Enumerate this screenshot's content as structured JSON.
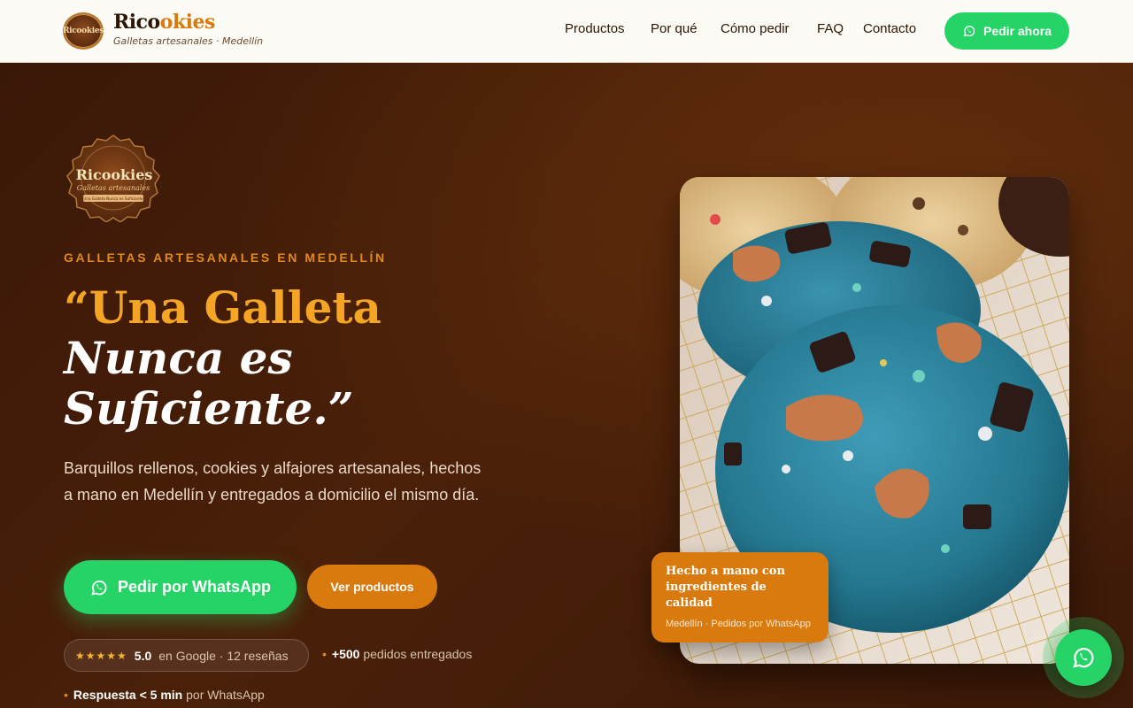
{
  "brand": {
    "name_part1": "Rico",
    "name_part2": "okies",
    "tagline": "Galletas artesanales · Medellín",
    "logo_text": "Ricookies"
  },
  "nav": {
    "items": [
      "Productos",
      "Por qué",
      "Cómo pedir",
      "FAQ",
      "Contacto"
    ],
    "cta_label": "Pedir ahora"
  },
  "hero": {
    "badge": {
      "title": "Ricookies",
      "subtitle": "Galletas artesanales",
      "ribbon": "Una Galleta Nunca es Suficiente"
    },
    "kicker": "GALLETAS ARTESANALES EN MEDELLÍN",
    "headline": {
      "line1": "“Una Galleta",
      "line2": "Nunca es",
      "line3": "Suficiente.”"
    },
    "lead": "Barquillos rellenos, cookies y alfajores artesanales, hechos a mano en Medellín y entregados a domicilio el mismo día.",
    "primary_cta": "Pedir por WhatsApp",
    "secondary_cta": "Ver productos",
    "rating": {
      "stars": "★★★★★",
      "score": "5.0",
      "source": "en Google · 12 reseñas"
    },
    "orders": {
      "value": "+500",
      "label": "pedidos entregados"
    },
    "response": {
      "value": "Respuesta < 5 min",
      "label": "por WhatsApp"
    }
  },
  "photo_card": {
    "title": "Hecho a mano con ingredientes de calidad",
    "subtitle": "Medellín · Pedidos por WhatsApp"
  },
  "colors": {
    "brand_brown": "#3a1807",
    "accent_orange": "#d97a0f",
    "whatsapp_green": "#25d366",
    "gold": "#f5a524"
  },
  "icons": {
    "whatsapp": "whatsapp-icon",
    "star": "star-icon"
  }
}
